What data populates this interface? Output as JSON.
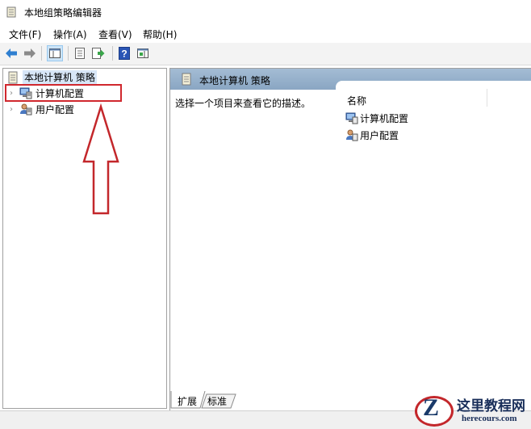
{
  "window": {
    "title": "本地组策略编辑器",
    "app_icon": "policy-editor-icon"
  },
  "menu": [
    {
      "label": "文件(F)"
    },
    {
      "label": "操作(A)"
    },
    {
      "label": "查看(V)"
    },
    {
      "label": "帮助(H)"
    }
  ],
  "toolbar": {
    "buttons": [
      "back-arrow-icon",
      "forward-arrow-icon",
      "show-hide-console-tree-icon",
      "properties-icon",
      "export-list-icon",
      "help-icon",
      "show-hide-action-pane-icon"
    ]
  },
  "tree": {
    "root": "本地计算机 策略",
    "items": [
      {
        "label": "计算机配置",
        "icon": "computer-config-icon"
      },
      {
        "label": "用户配置",
        "icon": "user-config-icon"
      }
    ]
  },
  "content": {
    "header": "本地计算机 策略",
    "description": "选择一个项目来查看它的描述。",
    "column_header": "名称",
    "items": [
      {
        "label": "计算机配置"
      },
      {
        "label": "用户配置"
      }
    ]
  },
  "tabs": [
    {
      "label": "扩展"
    },
    {
      "label": "标准"
    }
  ],
  "annotation": {
    "highlight_color": "#d0282e"
  },
  "watermark": {
    "title": "这里教程网",
    "url": "herecours.com"
  },
  "colors": {
    "header_bg": "#8aa6c3",
    "selection_bg": "#d7e6f7"
  }
}
